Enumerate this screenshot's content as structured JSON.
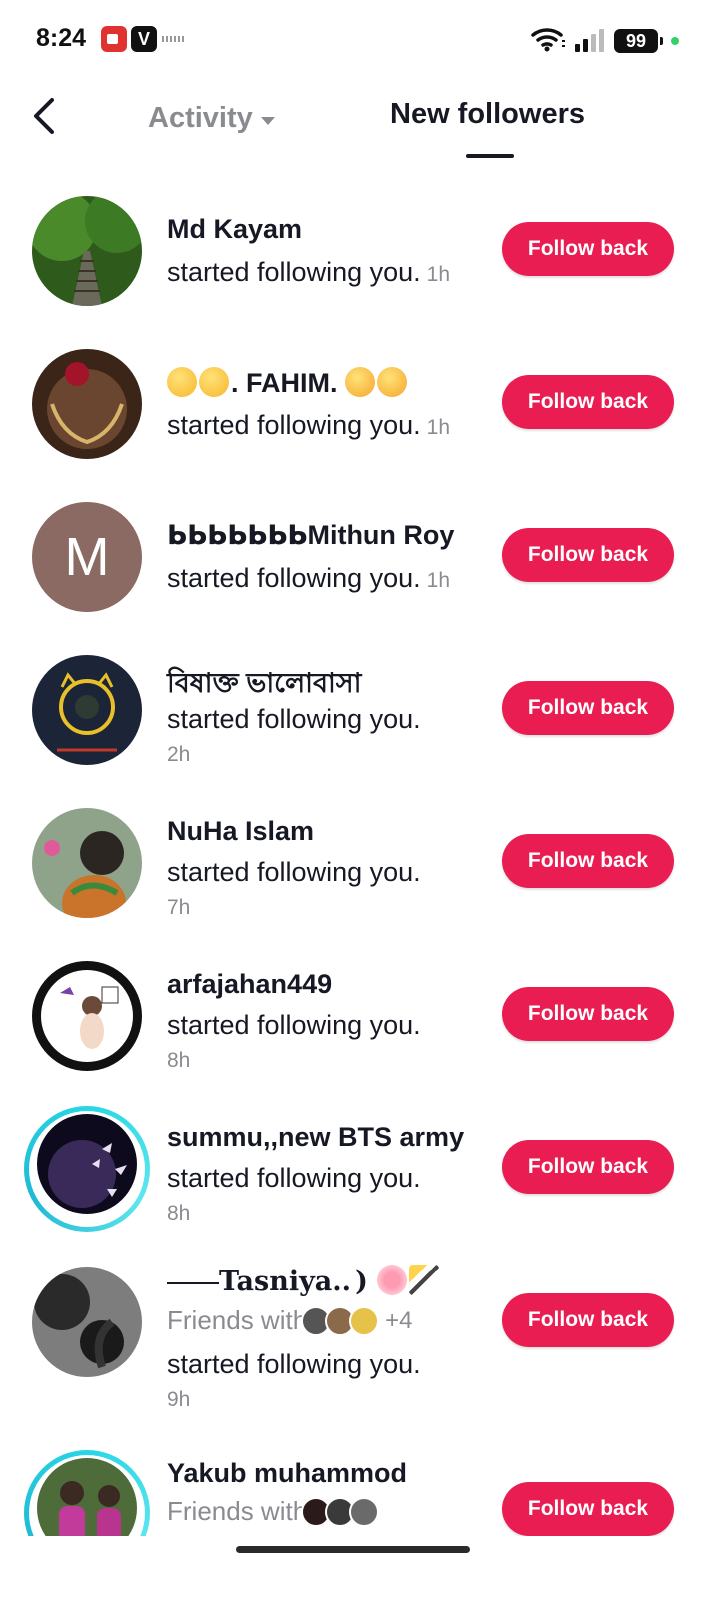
{
  "status_bar": {
    "time": "8:24",
    "v_app_letter": "V",
    "battery": "99",
    "icons": [
      "screen-record-icon",
      "v-app-icon",
      "wifi-icon",
      "signal-icon",
      "battery-icon"
    ]
  },
  "header": {
    "back_icon": "chevron-left-icon",
    "activity_tab": "Activity",
    "new_followers_tab": "New followers"
  },
  "followers": [
    {
      "name": "Md Kayam",
      "message": "started following you.",
      "time": "1h",
      "button": "Follow back"
    },
    {
      "name": ". FAHIM.",
      "message": "started following you.",
      "time": "1h",
      "button": "Follow back"
    },
    {
      "name": "ᖯᖯᖯᖯᖯᖯᖯMithun Roy",
      "avatar_letter": "M",
      "message": "started following you.",
      "time": "1h",
      "button": "Follow back"
    },
    {
      "name": "বিষাক্ত ভালোবাসা",
      "message": "started following you.",
      "time": "2h",
      "button": "Follow back"
    },
    {
      "name": "NuHa Islam",
      "message": "started following you.",
      "time": "7h",
      "button": "Follow back"
    },
    {
      "name": "arfajahan449",
      "message": "started following you.",
      "time": "8h",
      "button": "Follow back"
    },
    {
      "name": "summu,,new BTS army",
      "message": "started following you.",
      "time": "8h",
      "button": "Follow back"
    },
    {
      "name": "Tasniya..",
      "friends_label": "Friends with",
      "friends_extra": "+4",
      "message": "started following you.",
      "time": "9h",
      "button": "Follow back"
    },
    {
      "name": "Yakub muhammod",
      "friends_label": "Friends with",
      "button": "Follow back"
    }
  ],
  "colors": {
    "follow_button": "#ea1d52",
    "text": "#161823",
    "secondary": "#8a8b91",
    "story_ring": "#28d6e6"
  }
}
